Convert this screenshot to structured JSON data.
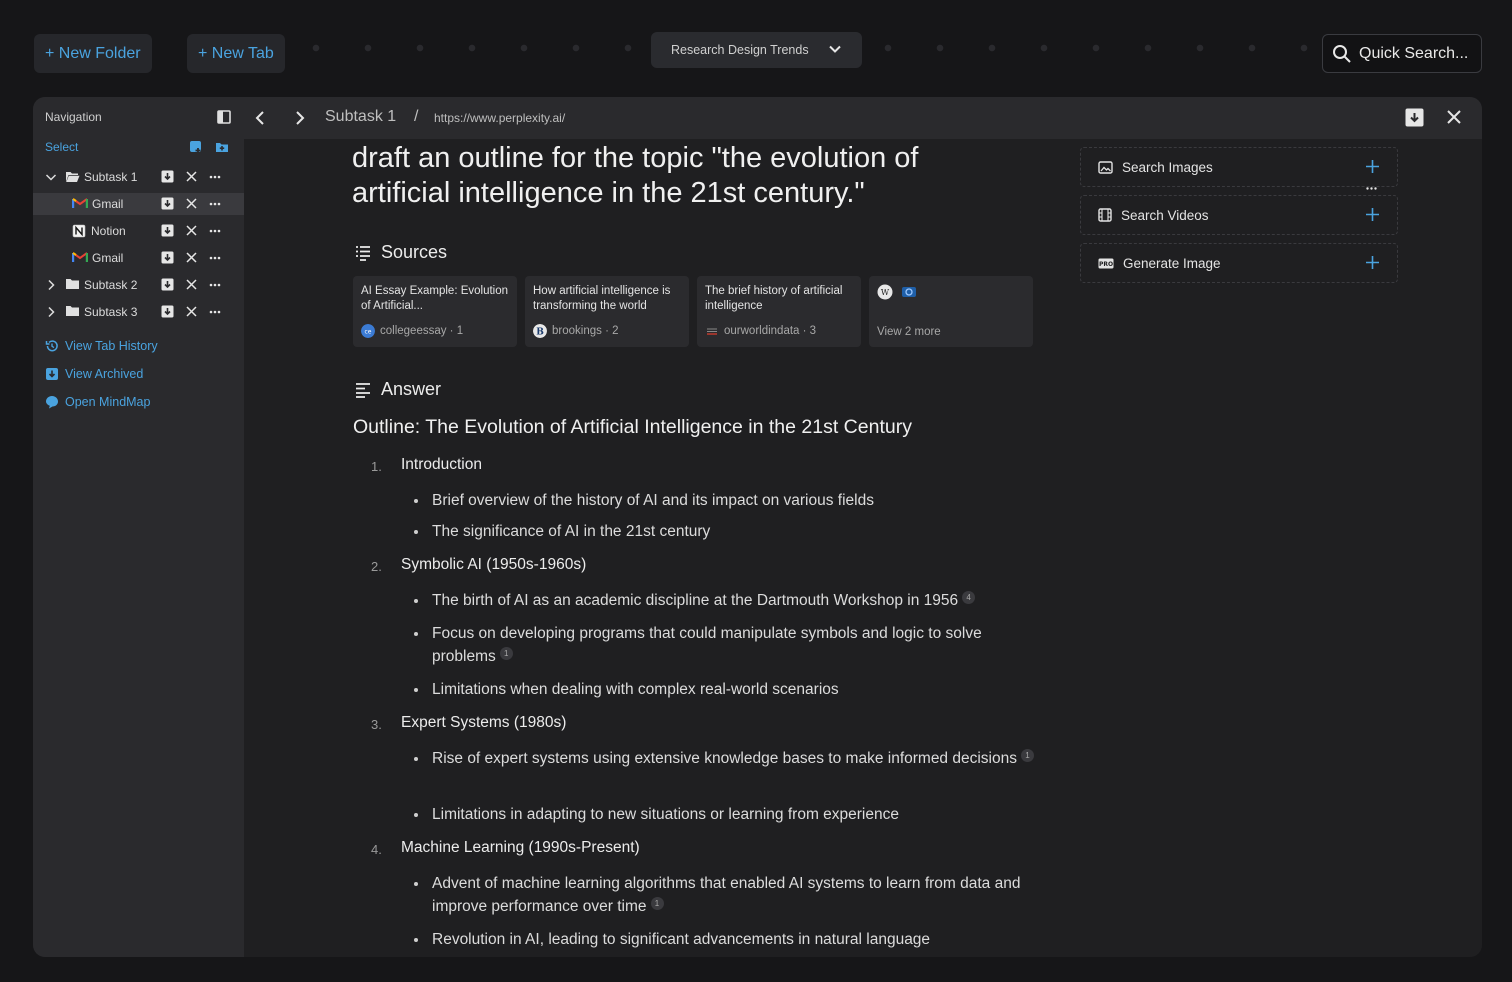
{
  "colors": {
    "accent": "#4aa3df",
    "background": "#161618",
    "panel": "#2a2a2d"
  },
  "top": {
    "new_folder": "+ New Folder",
    "new_tab": "+ New Tab",
    "workspace": "Research Design Trends",
    "quick_search": "Quick Search..."
  },
  "sidebar": {
    "title": "Navigation",
    "select": "Select",
    "tree": [
      {
        "label": "Subtask 1",
        "icon": "folder-open-icon"
      },
      {
        "label": "Gmail",
        "icon": "gmail-icon"
      },
      {
        "label": "Notion",
        "icon": "notion-icon"
      },
      {
        "label": "Gmail",
        "icon": "gmail-icon"
      },
      {
        "label": "Subtask 2",
        "icon": "folder-icon"
      },
      {
        "label": "Subtask 3",
        "icon": "folder-icon"
      }
    ],
    "links": [
      "View Tab History",
      "View Archived",
      "Open MindMap"
    ]
  },
  "toolbar": {
    "crumb": "Subtask 1",
    "separator": "/",
    "url": "https://www.perplexity.ai/"
  },
  "content": {
    "query": "draft an outline for the topic \"the evolution of artificial intelligence in the 21st century.\"",
    "sources_heading": "Sources",
    "sources": [
      {
        "title": "AI Essay Example: Evolution of Artificial...",
        "site": "collegeessay",
        "n": "1"
      },
      {
        "title": "How artificial intelligence is transforming the world",
        "site": "brookings",
        "n": "2"
      },
      {
        "title": "The brief history of artificial intelligence",
        "site": "ourworldindata",
        "n": "3"
      }
    ],
    "view_more": "View 2 more",
    "answer_heading": "Answer",
    "outline_title": "Outline: The Evolution of Artificial Intelligence in the 21st Century",
    "sections": [
      {
        "num": "1.",
        "title": "Introduction",
        "bullets": [
          {
            "text": "Brief overview of the history of AI and its impact on various fields",
            "cite": ""
          },
          {
            "text": "The significance of AI in the 21st century",
            "cite": ""
          }
        ]
      },
      {
        "num": "2.",
        "title": "Symbolic AI (1950s-1960s)",
        "bullets": [
          {
            "text": "The birth of AI as an academic discipline at the Dartmouth Workshop in 1956",
            "cite": "4"
          },
          {
            "text": "Focus on developing programs that could manipulate symbols and logic to solve problems",
            "cite": "1"
          },
          {
            "text": "Limitations when dealing with complex real-world scenarios",
            "cite": ""
          }
        ]
      },
      {
        "num": "3.",
        "title": "Expert Systems (1980s)",
        "bullets": [
          {
            "text": "Rise of expert systems using extensive knowledge bases to make informed decisions",
            "cite": "1"
          },
          {
            "text": "Limitations in adapting to new situations or learning from experience",
            "cite": ""
          }
        ]
      },
      {
        "num": "4.",
        "title": "Machine Learning (1990s-Present)",
        "bullets": [
          {
            "text": "Advent of machine learning algorithms that enabled AI systems to learn from data and improve performance over time",
            "cite": "1"
          },
          {
            "text": "Revolution in AI, leading to significant advancements in natural language",
            "cite": ""
          }
        ]
      }
    ],
    "tools": [
      "Search Images",
      "Search Videos",
      "Generate Image"
    ]
  }
}
